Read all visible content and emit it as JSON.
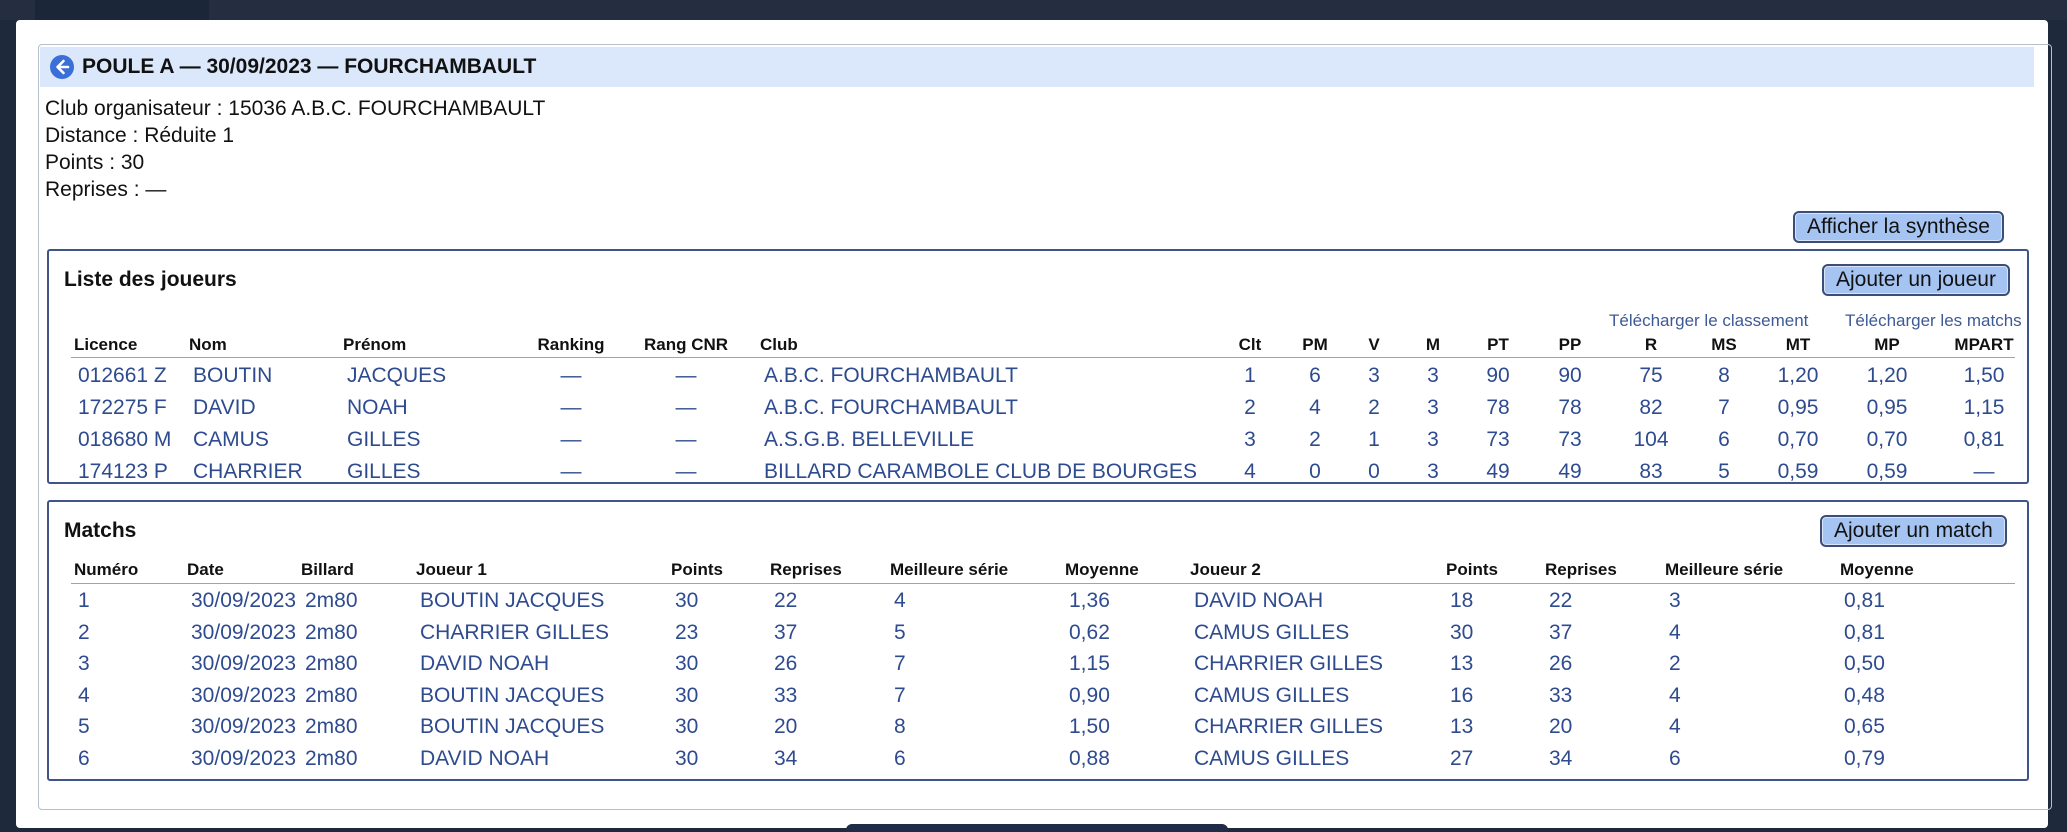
{
  "poule": {
    "title": "POULE A — 30/09/2023 — FOURCHAMBAULT",
    "info": [
      "Club organisateur : 15036 A.B.C. FOURCHAMBAULT",
      "Distance : Réduite 1",
      "Points : 30",
      "Reprises : —"
    ],
    "synthese_label": "Afficher la synthèse"
  },
  "players": {
    "title": "Liste des joueurs",
    "add_label": "Ajouter un joueur",
    "download_ranking": "Télécharger le classement",
    "download_matches": "Télécharger les matchs",
    "columns": [
      "Licence",
      "Nom",
      "Prénom",
      "Ranking",
      "Rang CNR",
      "Club",
      "Clt",
      "PM",
      "V",
      "M",
      "PT",
      "PP",
      "R",
      "MS",
      "MT",
      "MP",
      "MPART"
    ],
    "rows": [
      [
        "012661 Z",
        "BOUTIN",
        "JACQUES",
        "—",
        "—",
        "A.B.C. FOURCHAMBAULT",
        "1",
        "6",
        "3",
        "3",
        "90",
        "90",
        "75",
        "8",
        "1,20",
        "1,20",
        "1,50"
      ],
      [
        "172275 F",
        "DAVID",
        "NOAH",
        "—",
        "—",
        "A.B.C. FOURCHAMBAULT",
        "2",
        "4",
        "2",
        "3",
        "78",
        "78",
        "82",
        "7",
        "0,95",
        "0,95",
        "1,15"
      ],
      [
        "018680 M",
        "CAMUS",
        "GILLES",
        "—",
        "—",
        "A.S.G.B. BELLEVILLE",
        "3",
        "2",
        "1",
        "3",
        "73",
        "73",
        "104",
        "6",
        "0,70",
        "0,70",
        "0,81"
      ],
      [
        "174123 P",
        "CHARRIER",
        "GILLES",
        "—",
        "—",
        "BILLARD CARAMBOLE CLUB DE BOURGES",
        "4",
        "0",
        "0",
        "3",
        "49",
        "49",
        "83",
        "5",
        "0,59",
        "0,59",
        "—"
      ]
    ]
  },
  "matches": {
    "title": "Matchs",
    "add_label": "Ajouter un match",
    "columns": [
      "Numéro",
      "Date",
      "Billard",
      "Joueur 1",
      "Points",
      "Reprises",
      "Meilleure série",
      "Moyenne",
      "Joueur 2",
      "Points",
      "Reprises",
      "Meilleure série",
      "Moyenne"
    ],
    "rows": [
      [
        "1",
        "30/09/2023",
        "2m80",
        "BOUTIN JACQUES",
        "30",
        "22",
        "4",
        "1,36",
        "DAVID NOAH",
        "18",
        "22",
        "3",
        "0,81"
      ],
      [
        "2",
        "30/09/2023",
        "2m80",
        "CHARRIER GILLES",
        "23",
        "37",
        "5",
        "0,62",
        "CAMUS GILLES",
        "30",
        "37",
        "4",
        "0,81"
      ],
      [
        "3",
        "30/09/2023",
        "2m80",
        "DAVID NOAH",
        "30",
        "26",
        "7",
        "1,15",
        "CHARRIER GILLES",
        "13",
        "26",
        "2",
        "0,50"
      ],
      [
        "4",
        "30/09/2023",
        "2m80",
        "BOUTIN JACQUES",
        "30",
        "33",
        "7",
        "0,90",
        "CAMUS GILLES",
        "16",
        "33",
        "4",
        "0,48"
      ],
      [
        "5",
        "30/09/2023",
        "2m80",
        "BOUTIN JACQUES",
        "30",
        "20",
        "8",
        "1,50",
        "CHARRIER GILLES",
        "13",
        "20",
        "4",
        "0,65"
      ],
      [
        "6",
        "30/09/2023",
        "2m80",
        "DAVID NOAH",
        "30",
        "34",
        "6",
        "0,88",
        "CAMUS GILLES",
        "27",
        "34",
        "6",
        "0,79"
      ]
    ]
  },
  "colors": {
    "accent": "#2e4b8f",
    "button": "#a6c4f2",
    "header_bg": "#dbe8fc"
  }
}
